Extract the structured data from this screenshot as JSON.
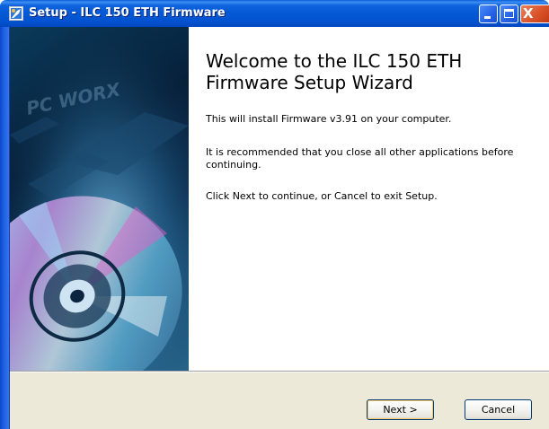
{
  "window": {
    "title": "Setup - ILC 150 ETH Firmware",
    "titlebar_color": "#0458d4",
    "controls": {
      "minimize": "minimize-icon",
      "maximize": "maximize-icon",
      "close": "close-icon",
      "close_glyph": "X"
    }
  },
  "banner": {
    "image": "pc-worx-cd-banner",
    "logo_text": "PC WORX"
  },
  "main": {
    "title": "Welcome to the ILC 150 ETH Firmware Setup Wizard",
    "paragraphs": [
      "This will install Firmware v3.91 on your computer.",
      "It is recommended that you close all other applications before continuing.",
      "Click Next to continue, or Cancel to exit Setup."
    ]
  },
  "footer": {
    "next_label": "Next >",
    "cancel_label": "Cancel"
  }
}
